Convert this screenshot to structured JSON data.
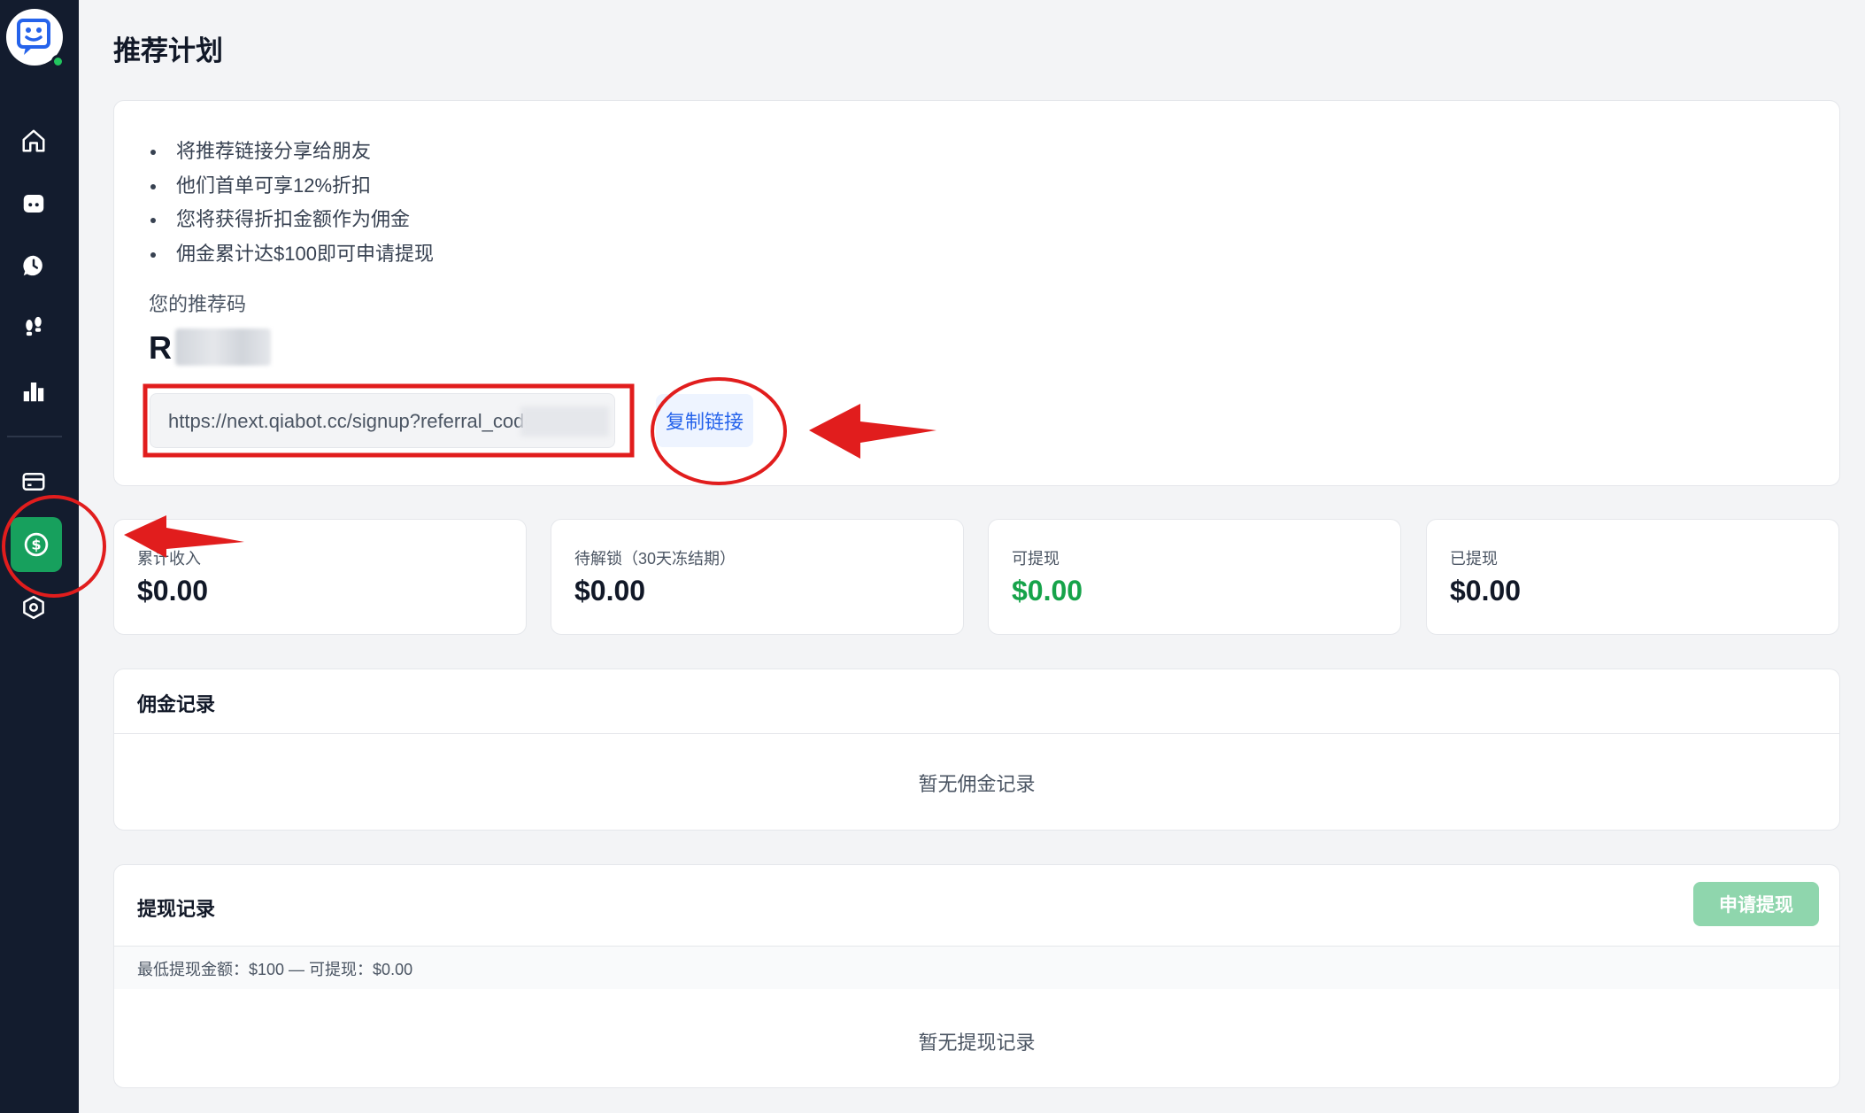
{
  "page": {
    "title": "推荐计划"
  },
  "sidebar": {
    "items": [
      {
        "icon": "home-icon"
      },
      {
        "icon": "robot-icon"
      },
      {
        "icon": "chat-history-icon"
      },
      {
        "icon": "footprints-icon"
      },
      {
        "icon": "bar-chart-icon"
      },
      {
        "icon": "credit-card-icon"
      },
      {
        "icon": "dollar-icon",
        "active": true
      },
      {
        "icon": "settings-hexagon-icon"
      }
    ]
  },
  "referral": {
    "bullets": [
      "将推荐链接分享给朋友",
      "他们首单可享12%折扣",
      "您将获得折扣金额作为佣金",
      "佣金累计达$100即可申请提现"
    ],
    "code_label": "您的推荐码",
    "code_value": "R",
    "link": "https://next.qiabot.cc/signup?referral_code=",
    "copy_label": "复制链接"
  },
  "stats": [
    {
      "label": "累计收入",
      "value": "$0.00"
    },
    {
      "label": "待解锁（30天冻结期）",
      "value": "$0.00"
    },
    {
      "label": "可提现",
      "value": "$0.00",
      "color": "#16a34a"
    },
    {
      "label": "已提现",
      "value": "$0.00"
    }
  ],
  "commission": {
    "title": "佣金记录",
    "empty": "暂无佣金记录"
  },
  "withdrawal": {
    "title": "提现记录",
    "apply_label": "申请提现",
    "min_text": "最低提现金额：$100 — 可提现：$0.00",
    "empty": "暂无提现记录"
  },
  "colors": {
    "sidebar_bg": "#131c2e",
    "accent_green": "#17a05d",
    "link_blue": "#2563eb",
    "annotation_red": "#e11d1d"
  }
}
